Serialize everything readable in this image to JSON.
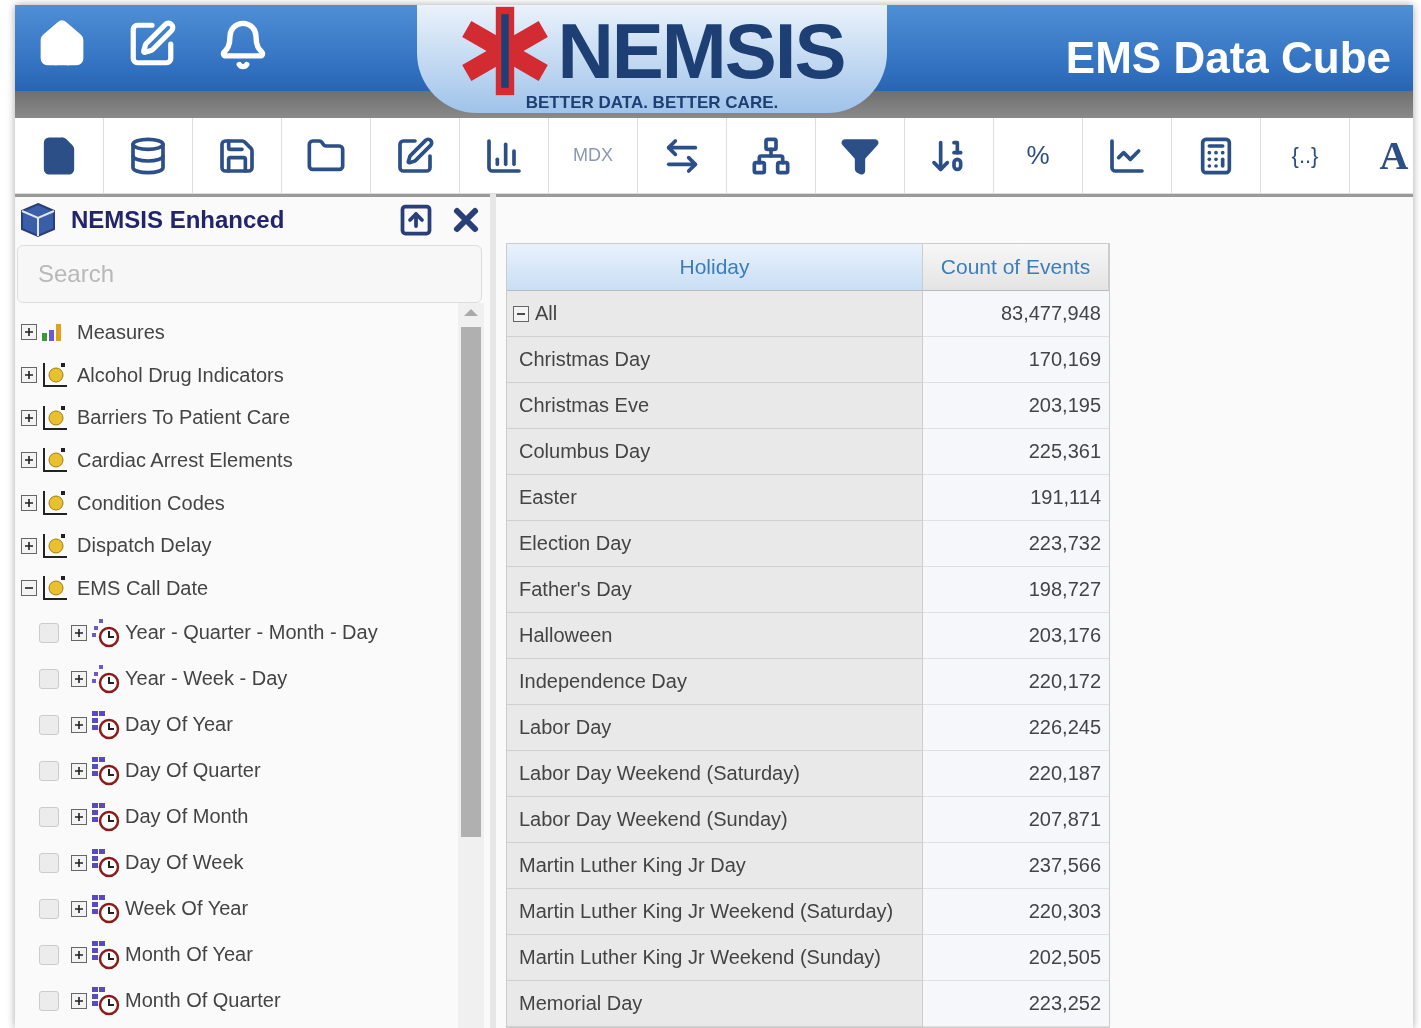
{
  "header": {
    "logo_text": "NEMSIS",
    "tagline": "BETTER DATA. BETTER CARE.",
    "title": "EMS Data Cube"
  },
  "toolbar": [
    {
      "kind": "icon"
    },
    {
      "kind": "icon"
    },
    {
      "kind": "icon"
    },
    {
      "kind": "icon"
    },
    {
      "kind": "icon"
    },
    {
      "kind": "icon"
    },
    {
      "kind": "text",
      "label": "MDX"
    },
    {
      "kind": "icon"
    },
    {
      "kind": "icon"
    },
    {
      "kind": "icon"
    },
    {
      "kind": "icon"
    },
    {
      "kind": "text",
      "label": "%"
    },
    {
      "kind": "icon"
    },
    {
      "kind": "icon"
    },
    {
      "kind": "text",
      "label": "{..}"
    },
    {
      "kind": "text",
      "label": "A"
    }
  ],
  "panel": {
    "title": "NEMSIS Enhanced",
    "search": {
      "placeholder": "Search"
    },
    "tree": [
      {
        "label": "Measures",
        "kind": "measures",
        "expanded": false
      },
      {
        "label": "Alcohol Drug Indicators",
        "kind": "dimension",
        "expanded": false
      },
      {
        "label": "Barriers To Patient Care",
        "kind": "dimension",
        "expanded": false
      },
      {
        "label": "Cardiac Arrest Elements",
        "kind": "dimension",
        "expanded": false
      },
      {
        "label": "Condition Codes",
        "kind": "dimension",
        "expanded": false
      },
      {
        "label": "Dispatch Delay",
        "kind": "dimension",
        "expanded": false
      },
      {
        "label": "EMS Call Date",
        "kind": "dimension",
        "expanded": true,
        "children": [
          {
            "label": "Year - Quarter - Month - Day",
            "kind": "hierarchy",
            "checked": false,
            "expanded": false
          },
          {
            "label": "Year - Week - Day",
            "kind": "hierarchy",
            "checked": false,
            "expanded": false
          },
          {
            "label": "Day Of Year",
            "kind": "attribute",
            "checked": false,
            "expanded": false
          },
          {
            "label": "Day Of Quarter",
            "kind": "attribute",
            "checked": false,
            "expanded": false
          },
          {
            "label": "Day Of Month",
            "kind": "attribute",
            "checked": false,
            "expanded": false
          },
          {
            "label": "Day Of Week",
            "kind": "attribute",
            "checked": false,
            "expanded": false
          },
          {
            "label": "Week Of Year",
            "kind": "attribute",
            "checked": false,
            "expanded": false
          },
          {
            "label": "Month Of Year",
            "kind": "attribute",
            "checked": false,
            "expanded": false
          },
          {
            "label": "Month Of Quarter",
            "kind": "attribute",
            "checked": false,
            "expanded": false
          }
        ]
      }
    ]
  },
  "table": {
    "columns": [
      "Holiday",
      "Count of Events"
    ],
    "total": {
      "label": "All",
      "value": "83,477,948",
      "expanded": true
    },
    "rows": [
      {
        "label": "Christmas Day",
        "value": "170,169"
      },
      {
        "label": "Christmas Eve",
        "value": "203,195"
      },
      {
        "label": "Columbus Day",
        "value": "225,361"
      },
      {
        "label": "Easter",
        "value": "191,114"
      },
      {
        "label": "Election Day",
        "value": "223,732"
      },
      {
        "label": "Father's Day",
        "value": "198,727"
      },
      {
        "label": "Halloween",
        "value": "203,176"
      },
      {
        "label": "Independence Day",
        "value": "220,172"
      },
      {
        "label": "Labor Day",
        "value": "226,245"
      },
      {
        "label": "Labor Day Weekend (Saturday)",
        "value": "220,187"
      },
      {
        "label": "Labor Day Weekend (Sunday)",
        "value": "207,871"
      },
      {
        "label": "Martin Luther King Jr Day",
        "value": "237,566"
      },
      {
        "label": "Martin Luther King Jr Weekend (Saturday)",
        "value": "220,303"
      },
      {
        "label": "Martin Luther King Jr Weekend (Sunday)",
        "value": "202,505"
      },
      {
        "label": "Memorial Day",
        "value": "223,252"
      }
    ]
  }
}
